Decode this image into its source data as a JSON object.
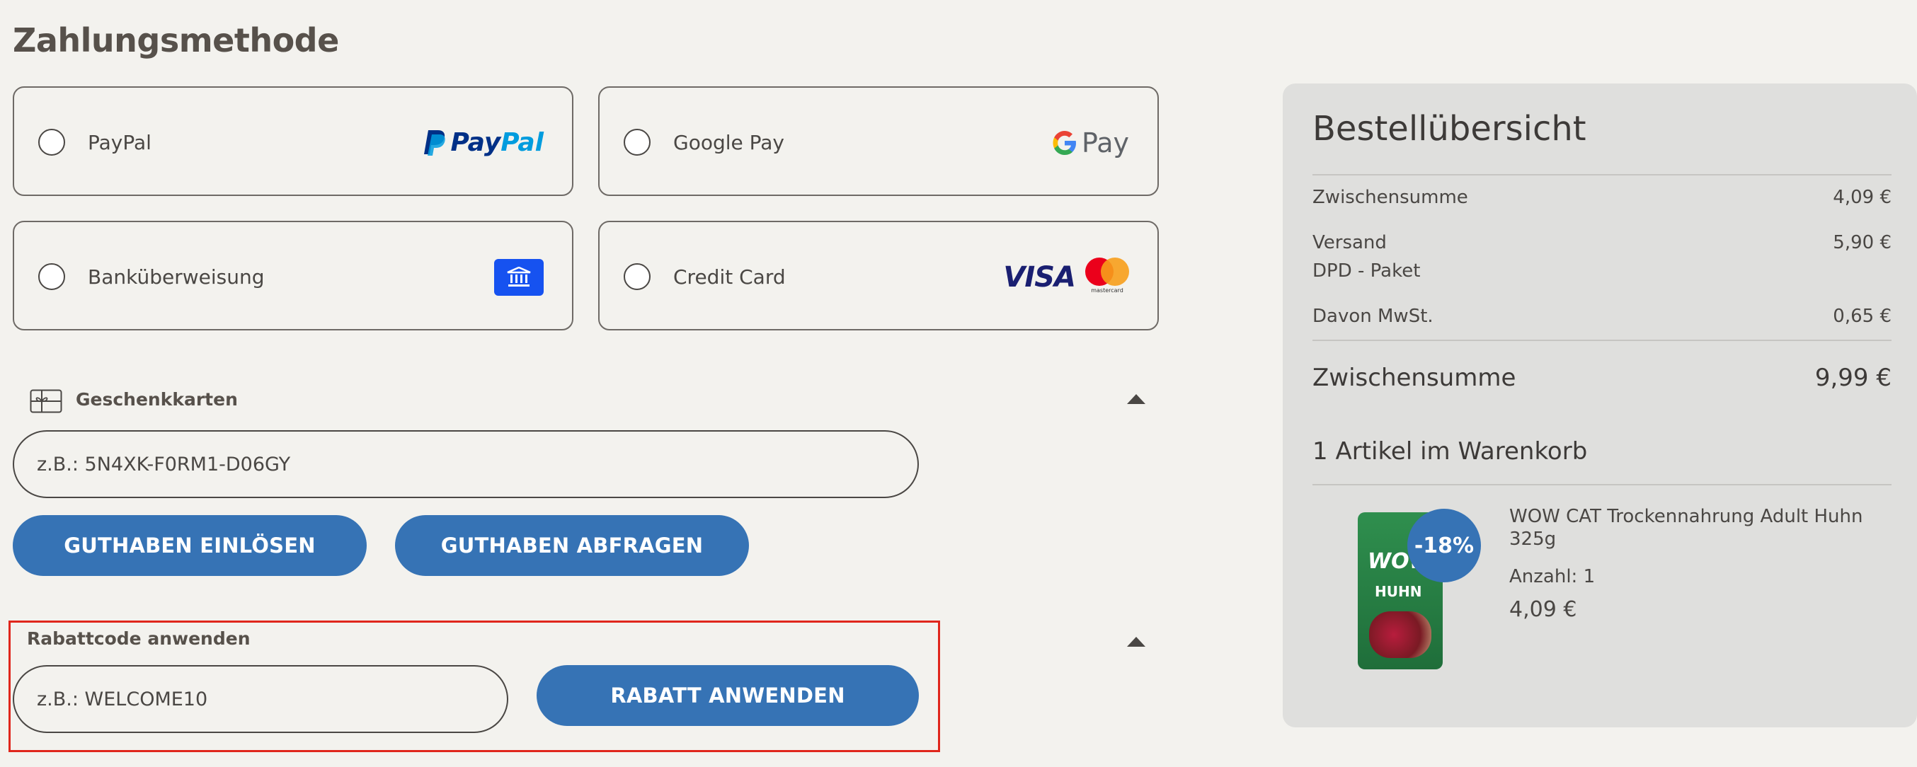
{
  "page_title": "Zahlungsmethode",
  "payment_methods": [
    {
      "label": "PayPal",
      "logo_text": "PayPal",
      "icon": "paypal-logo"
    },
    {
      "label": "Google Pay",
      "logo_text": "Pay",
      "icon": "google-pay-logo"
    },
    {
      "label": "Banküberweisung",
      "icon": "bank-icon"
    },
    {
      "label": "Credit Card",
      "logo_text": "VISA",
      "mastercard_text": "mastercard",
      "icon": "visa-mastercard-logo"
    }
  ],
  "gift_cards": {
    "heading": "Geschenkkarten",
    "placeholder": "z.B.: 5N4XK-F0RM1-D06GY",
    "redeem_label": "GUTHABEN EINLÖSEN",
    "check_label": "GUTHABEN ABFRAGEN"
  },
  "discount": {
    "heading": "Rabattcode anwenden",
    "placeholder": "z.B.: WELCOME10",
    "apply_label": "RABATT ANWENDEN"
  },
  "summary": {
    "title": "Bestellübersicht",
    "subtotal_label": "Zwischensumme",
    "subtotal_value": "4,09 €",
    "shipping_label": "Versand",
    "shipping_method": "DPD - Paket",
    "shipping_value": "5,90 €",
    "vat_label": "Davon MwSt.",
    "vat_value": "0,65 €",
    "total_label": "Zwischensumme",
    "total_value": "9,99 €",
    "cart_count_label": "1 Artikel im Warenkorb",
    "item": {
      "name": "WOW CAT Trockennahrung Adult Huhn 325g",
      "quantity": "Anzahl: 1",
      "price": "4,09 €",
      "discount_badge": "-18%",
      "package_brand": "WOW",
      "package_flavor": "HUHN"
    }
  },
  "colors": {
    "background": "#f3f2ee",
    "primary_button": "#3673b5",
    "summary_panel": "#dfdfdd",
    "highlight": "#e0261c",
    "bank_icon": "#1652f0"
  }
}
